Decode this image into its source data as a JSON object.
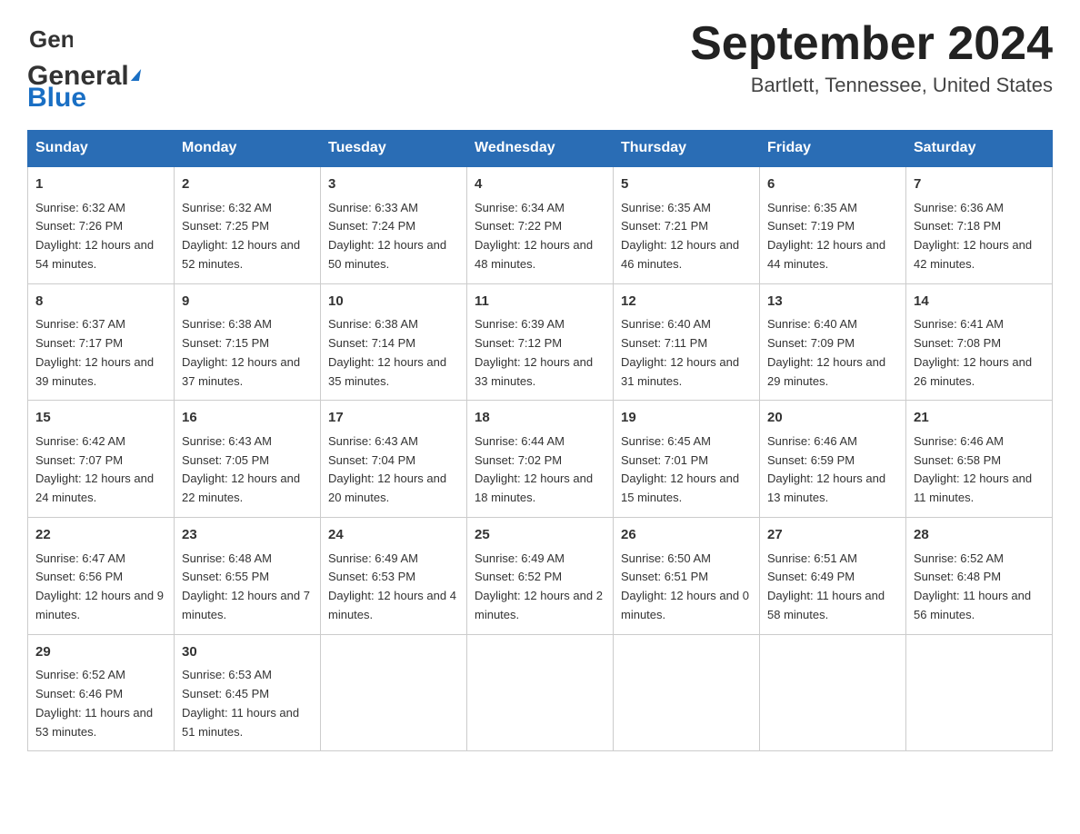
{
  "header": {
    "logo_general": "General",
    "logo_blue": "Blue",
    "title": "September 2024",
    "subtitle": "Bartlett, Tennessee, United States"
  },
  "days_of_week": [
    "Sunday",
    "Monday",
    "Tuesday",
    "Wednesday",
    "Thursday",
    "Friday",
    "Saturday"
  ],
  "weeks": [
    [
      {
        "day": "1",
        "sunrise": "6:32 AM",
        "sunset": "7:26 PM",
        "daylight": "12 hours and 54 minutes."
      },
      {
        "day": "2",
        "sunrise": "6:32 AM",
        "sunset": "7:25 PM",
        "daylight": "12 hours and 52 minutes."
      },
      {
        "day": "3",
        "sunrise": "6:33 AM",
        "sunset": "7:24 PM",
        "daylight": "12 hours and 50 minutes."
      },
      {
        "day": "4",
        "sunrise": "6:34 AM",
        "sunset": "7:22 PM",
        "daylight": "12 hours and 48 minutes."
      },
      {
        "day": "5",
        "sunrise": "6:35 AM",
        "sunset": "7:21 PM",
        "daylight": "12 hours and 46 minutes."
      },
      {
        "day": "6",
        "sunrise": "6:35 AM",
        "sunset": "7:19 PM",
        "daylight": "12 hours and 44 minutes."
      },
      {
        "day": "7",
        "sunrise": "6:36 AM",
        "sunset": "7:18 PM",
        "daylight": "12 hours and 42 minutes."
      }
    ],
    [
      {
        "day": "8",
        "sunrise": "6:37 AM",
        "sunset": "7:17 PM",
        "daylight": "12 hours and 39 minutes."
      },
      {
        "day": "9",
        "sunrise": "6:38 AM",
        "sunset": "7:15 PM",
        "daylight": "12 hours and 37 minutes."
      },
      {
        "day": "10",
        "sunrise": "6:38 AM",
        "sunset": "7:14 PM",
        "daylight": "12 hours and 35 minutes."
      },
      {
        "day": "11",
        "sunrise": "6:39 AM",
        "sunset": "7:12 PM",
        "daylight": "12 hours and 33 minutes."
      },
      {
        "day": "12",
        "sunrise": "6:40 AM",
        "sunset": "7:11 PM",
        "daylight": "12 hours and 31 minutes."
      },
      {
        "day": "13",
        "sunrise": "6:40 AM",
        "sunset": "7:09 PM",
        "daylight": "12 hours and 29 minutes."
      },
      {
        "day": "14",
        "sunrise": "6:41 AM",
        "sunset": "7:08 PM",
        "daylight": "12 hours and 26 minutes."
      }
    ],
    [
      {
        "day": "15",
        "sunrise": "6:42 AM",
        "sunset": "7:07 PM",
        "daylight": "12 hours and 24 minutes."
      },
      {
        "day": "16",
        "sunrise": "6:43 AM",
        "sunset": "7:05 PM",
        "daylight": "12 hours and 22 minutes."
      },
      {
        "day": "17",
        "sunrise": "6:43 AM",
        "sunset": "7:04 PM",
        "daylight": "12 hours and 20 minutes."
      },
      {
        "day": "18",
        "sunrise": "6:44 AM",
        "sunset": "7:02 PM",
        "daylight": "12 hours and 18 minutes."
      },
      {
        "day": "19",
        "sunrise": "6:45 AM",
        "sunset": "7:01 PM",
        "daylight": "12 hours and 15 minutes."
      },
      {
        "day": "20",
        "sunrise": "6:46 AM",
        "sunset": "6:59 PM",
        "daylight": "12 hours and 13 minutes."
      },
      {
        "day": "21",
        "sunrise": "6:46 AM",
        "sunset": "6:58 PM",
        "daylight": "12 hours and 11 minutes."
      }
    ],
    [
      {
        "day": "22",
        "sunrise": "6:47 AM",
        "sunset": "6:56 PM",
        "daylight": "12 hours and 9 minutes."
      },
      {
        "day": "23",
        "sunrise": "6:48 AM",
        "sunset": "6:55 PM",
        "daylight": "12 hours and 7 minutes."
      },
      {
        "day": "24",
        "sunrise": "6:49 AM",
        "sunset": "6:53 PM",
        "daylight": "12 hours and 4 minutes."
      },
      {
        "day": "25",
        "sunrise": "6:49 AM",
        "sunset": "6:52 PM",
        "daylight": "12 hours and 2 minutes."
      },
      {
        "day": "26",
        "sunrise": "6:50 AM",
        "sunset": "6:51 PM",
        "daylight": "12 hours and 0 minutes."
      },
      {
        "day": "27",
        "sunrise": "6:51 AM",
        "sunset": "6:49 PM",
        "daylight": "11 hours and 58 minutes."
      },
      {
        "day": "28",
        "sunrise": "6:52 AM",
        "sunset": "6:48 PM",
        "daylight": "11 hours and 56 minutes."
      }
    ],
    [
      {
        "day": "29",
        "sunrise": "6:52 AM",
        "sunset": "6:46 PM",
        "daylight": "11 hours and 53 minutes."
      },
      {
        "day": "30",
        "sunrise": "6:53 AM",
        "sunset": "6:45 PM",
        "daylight": "11 hours and 51 minutes."
      },
      null,
      null,
      null,
      null,
      null
    ]
  ]
}
